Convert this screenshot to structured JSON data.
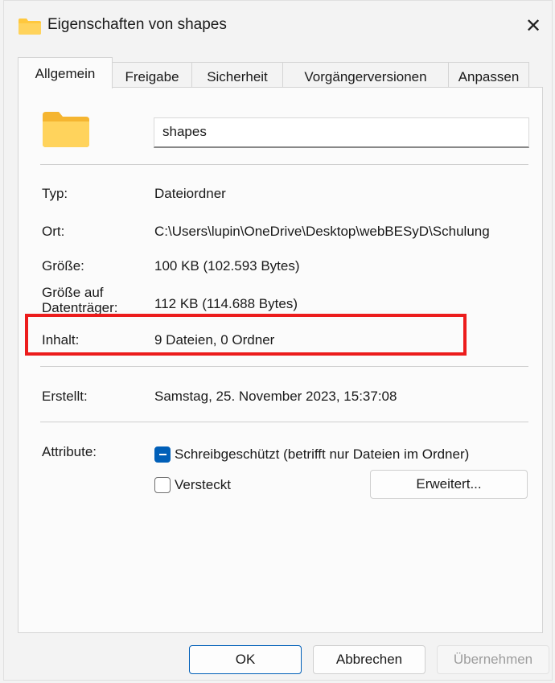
{
  "window": {
    "title": "Eigenschaften von shapes",
    "close_label": "✕"
  },
  "tabs": [
    "Allgemein",
    "Freigabe",
    "Sicherheit",
    "Vorgängerversionen",
    "Anpassen"
  ],
  "general": {
    "name_value": "shapes",
    "type_label": "Typ:",
    "type_value": "Dateiordner",
    "location_label": "Ort:",
    "location_value": "C:\\Users\\lupin\\OneDrive\\Desktop\\webBESyD\\Schulung",
    "size_label": "Größe:",
    "size_value": "100 KB (102.593 Bytes)",
    "disk_size_label": "Größe auf Datenträger:",
    "disk_size_value": "112 KB (114.688 Bytes)",
    "contents_label": "Inhalt:",
    "contents_value": "9 Dateien, 0 Ordner",
    "created_label": "Erstellt:",
    "created_value": "Samstag, 25. November 2023, 15:37:08",
    "attributes_label": "Attribute:",
    "readonly_label": "Schreibgeschützt (betrifft nur Dateien im Ordner)",
    "hidden_label": "Versteckt",
    "advanced_label": "Erweitert..."
  },
  "footer": {
    "ok_label": "OK",
    "cancel_label": "Abbrechen",
    "apply_label": "Übernehmen"
  },
  "colors": {
    "highlight": "#ec1c1c",
    "accent": "#005fb8",
    "folder": "#ffc83d"
  },
  "state": {
    "readonly_checked": "indeterminate",
    "hidden_checked": false
  }
}
